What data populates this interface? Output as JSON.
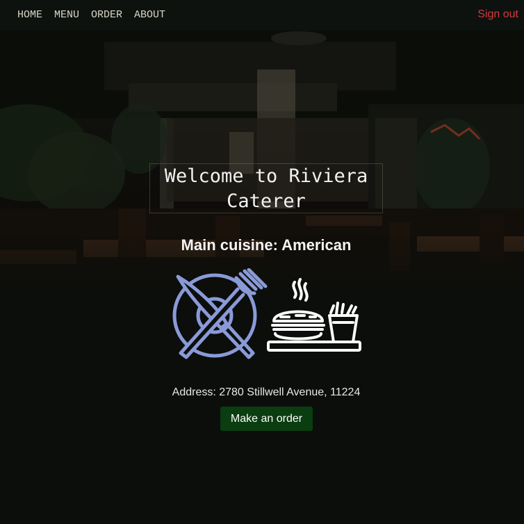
{
  "nav": {
    "links": [
      "HOME",
      "MENU",
      "ORDER",
      "ABOUT"
    ],
    "sign_out": "Sign out"
  },
  "hero": {
    "title": "Welcome to Riviera Caterer",
    "cuisine": "Main cuisine: American"
  },
  "icons": {
    "plate": "plate-with-cutlery-icon",
    "food": "burger-and-fries-tray-icon"
  },
  "details": {
    "address": "Address: 2780 Stillwell Avenue, 11224"
  },
  "actions": {
    "order_label": "Make an order"
  },
  "colors": {
    "sign_out": "#d4393f",
    "order_button": "#0a3d0f",
    "plate_icon": "#8a9ad8",
    "nav_text": "#d9d5c6"
  }
}
